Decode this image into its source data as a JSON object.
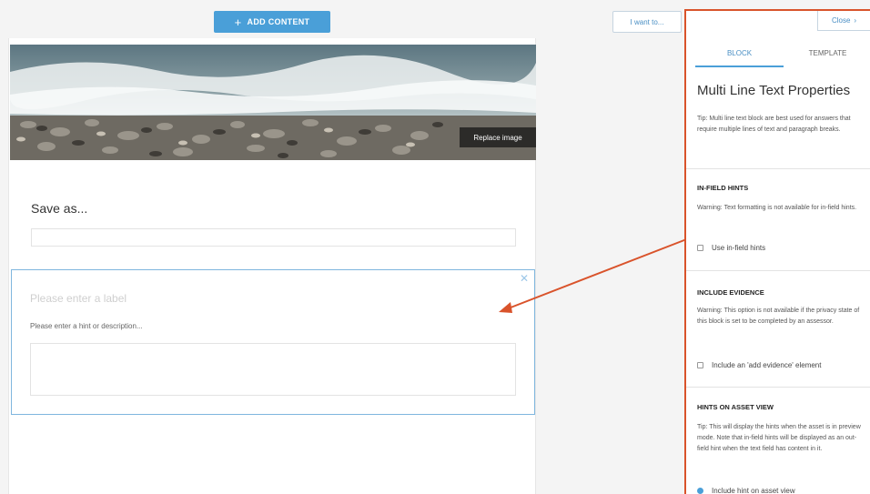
{
  "toolbar": {
    "add_content_label": "ADD CONTENT",
    "add_icon": "plus-icon",
    "i_want_to_label": "I want to..."
  },
  "page": {
    "replace_image_label": "Replace image",
    "save_as_label": "Save as...",
    "save_as_value": "",
    "block": {
      "label_placeholder": "Please enter a label",
      "hint_placeholder": "Please enter a hint or description...",
      "textarea_value": ""
    }
  },
  "panel": {
    "close_label": "Close",
    "close_icon": "chevron-right-icon",
    "tabs": [
      {
        "label": "BLOCK",
        "active": true
      },
      {
        "label": "TEMPLATE",
        "active": false
      }
    ],
    "title": "Multi Line Text Properties",
    "tip": "Tip: Multi line text block are best used for answers that require multiple lines of text and paragraph breaks.",
    "sections": [
      {
        "heading": "IN-FIELD HINTS",
        "text": "Warning: Text formatting is not available for in-field hints.",
        "checkbox_label": "Use in-field hints",
        "checked": false
      },
      {
        "heading": "INCLUDE EVIDENCE",
        "text": "Warning: This option is not available if the privacy state of this block is set to be completed by an assessor.",
        "checkbox_label": "Include an 'add evidence' element",
        "checked": false
      },
      {
        "heading": "HINTS ON ASSET VIEW",
        "text": "Tip: This will display the hints when the asset is in preview mode. Note that in-field hints will be displayed as an out-field hint when the text field has content in it.",
        "checkbox_label": "Include hint on asset view",
        "checked": true
      }
    ]
  },
  "colors": {
    "accent": "#4a9fd8",
    "annotation": "#d9532b"
  }
}
